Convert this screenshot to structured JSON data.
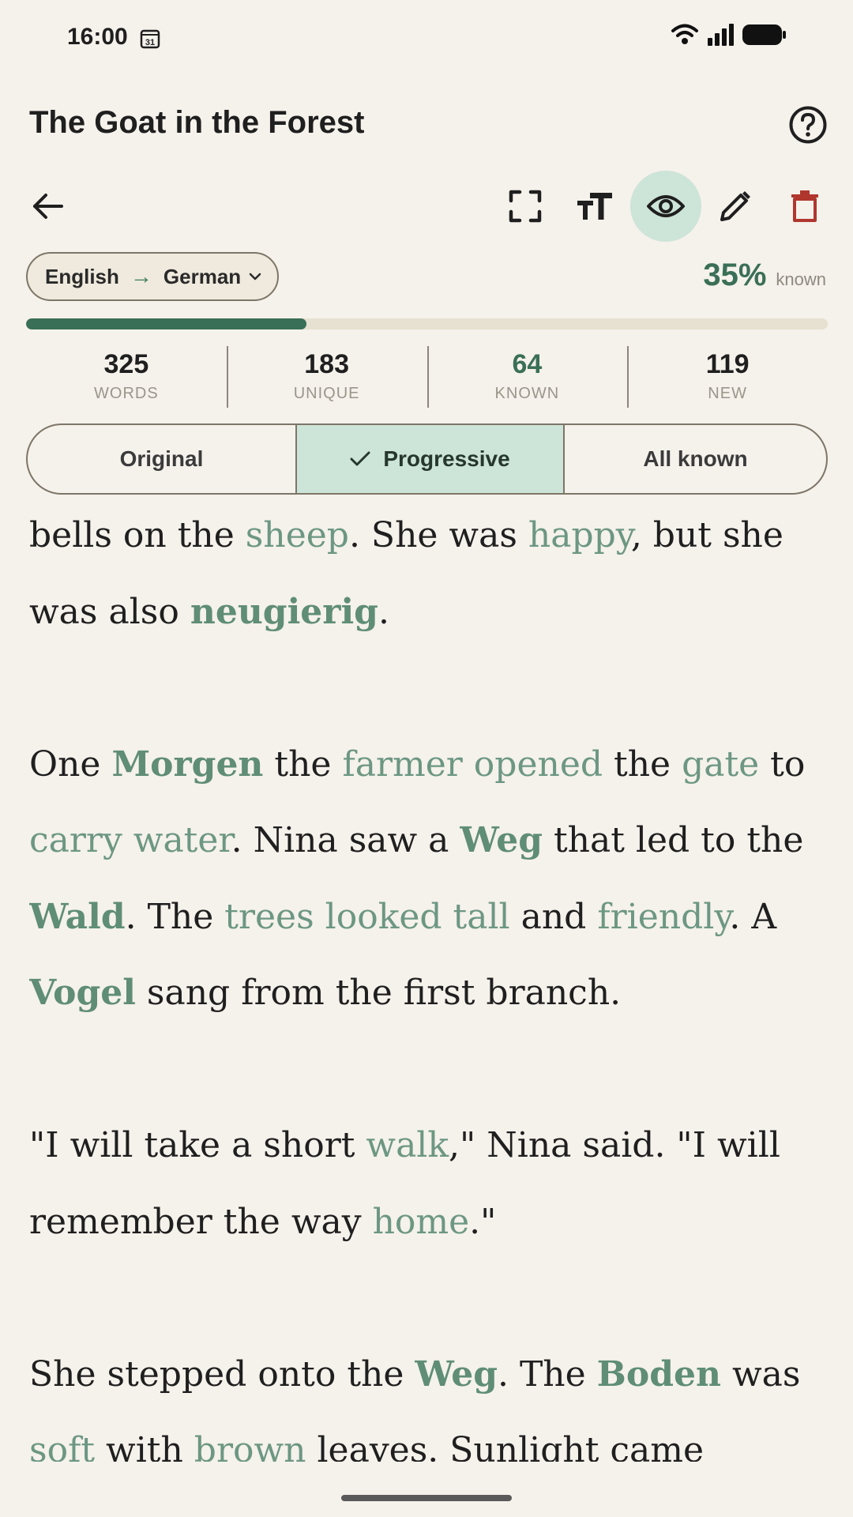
{
  "status_bar": {
    "time": "16:00",
    "calendar_day": "31"
  },
  "header": {
    "title": "The Goat in the Forest"
  },
  "toolbar": {
    "back": "back-icon",
    "fullscreen": "fullscreen-icon",
    "text_size": "text-size-icon",
    "visibility": "eye-icon",
    "edit": "pencil-icon",
    "delete": "trash-icon"
  },
  "language": {
    "from": "English",
    "to": "German"
  },
  "progress": {
    "percent_label": "35%",
    "known_label": "known",
    "fraction": 0.35
  },
  "stats": [
    {
      "value": "325",
      "label": "WORDS"
    },
    {
      "value": "183",
      "label": "UNIQUE"
    },
    {
      "value": "64",
      "label": "KNOWN"
    },
    {
      "value": "119",
      "label": "NEW"
    }
  ],
  "modes": {
    "original": "Original",
    "progressive": "Progressive",
    "all_known": "All known",
    "selected": "Progressive"
  },
  "reading": {
    "p1": [
      {
        "t": "bells on the "
      },
      {
        "t": "sheep",
        "s": "w"
      },
      {
        "t": ". She was "
      },
      {
        "t": "happy",
        "s": "w"
      },
      {
        "t": ", but she was also "
      },
      {
        "t": "neugierig",
        "s": "b"
      },
      {
        "t": "."
      }
    ],
    "p2": [
      {
        "t": "One "
      },
      {
        "t": "Morgen",
        "s": "b"
      },
      {
        "t": " the "
      },
      {
        "t": "farmer opened",
        "s": "w"
      },
      {
        "t": " the "
      },
      {
        "t": "gate",
        "s": "w"
      },
      {
        "t": " to "
      },
      {
        "t": "carry water",
        "s": "w"
      },
      {
        "t": ". Nina saw a "
      },
      {
        "t": "Weg",
        "s": "b"
      },
      {
        "t": " that led to the "
      },
      {
        "t": "Wald",
        "s": "b"
      },
      {
        "t": ". The "
      },
      {
        "t": "trees looked tall",
        "s": "w"
      },
      {
        "t": " and "
      },
      {
        "t": "friendly",
        "s": "w"
      },
      {
        "t": ". A "
      },
      {
        "t": "Vogel",
        "s": "b"
      },
      {
        "t": " sang from the first branch."
      }
    ],
    "p3": [
      {
        "t": "\"I will take a short "
      },
      {
        "t": "walk",
        "s": "w"
      },
      {
        "t": ",\" Nina said. \"I will remember the way "
      },
      {
        "t": "home",
        "s": "w"
      },
      {
        "t": ".\""
      }
    ],
    "p4": [
      {
        "t": "She stepped onto the "
      },
      {
        "t": "Weg",
        "s": "b"
      },
      {
        "t": ". The "
      },
      {
        "t": "Boden",
        "s": "b"
      },
      {
        "t": " was "
      },
      {
        "t": "soft",
        "s": "w"
      },
      {
        "t": " with "
      },
      {
        "t": "brown",
        "s": "w"
      },
      {
        "t": " leaves. Sunlight came"
      }
    ]
  },
  "colors": {
    "accent": "#3a6f57",
    "selected_bg": "#cde4d8",
    "background": "#f5f1eb",
    "delete": "#b0362e"
  }
}
